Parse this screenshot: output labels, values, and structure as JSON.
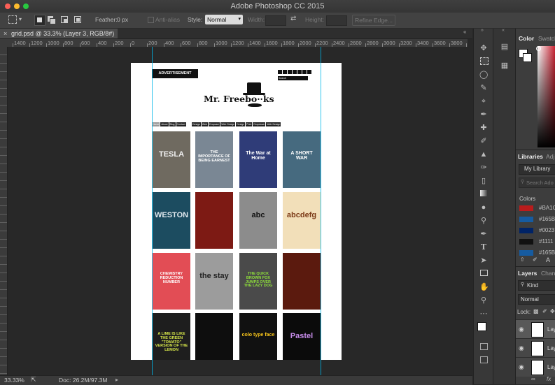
{
  "app": {
    "title": "Adobe Photoshop CC 2015"
  },
  "options_bar": {
    "feather_label": "Feather:",
    "feather_value": "0 px",
    "antialias_label": "Anti-alias",
    "style_label": "Style:",
    "style_value": "Normal",
    "width_label": "Width:",
    "height_label": "Height:",
    "refine_edge_label": "Refine Edge..."
  },
  "document": {
    "tab_title": "grid.psd @ 33.3% (Layer 3, RGB/8#) *"
  },
  "ruler": {
    "ticks": [
      "1400",
      "1200",
      "1000",
      "800",
      "600",
      "400",
      "200",
      "0",
      "200",
      "400",
      "600",
      "800",
      "1000",
      "1200",
      "1400",
      "1600",
      "1800",
      "2000",
      "2200",
      "2400",
      "2600",
      "2800",
      "3000",
      "3200",
      "3400",
      "3600",
      "3800",
      "4000"
    ]
  },
  "site": {
    "ad_label": "ADVERTISEMENT",
    "brand_name": "Mr. Freebo··ks",
    "search_label": "Search",
    "nav_left": [
      "Home",
      "About",
      "Blog",
      "Contact"
    ],
    "nav_right": [
      "Design",
      "Web",
      "Dropcam",
      "Web Design",
      "Design",
      "Print",
      "Dropdown",
      "Web Design"
    ],
    "books": [
      {
        "title": "TESLA",
        "subtitle": "",
        "bg": "#6f6a60",
        "fg": "#f0f0f0"
      },
      {
        "title": "THE IMPORTANCE OF BEING EARNEST",
        "subtitle": "",
        "bg": "#7a8794",
        "fg": "#ffffff"
      },
      {
        "title": "The War at Home",
        "subtitle": "",
        "bg": "#2f3c78",
        "fg": "#ffffff"
      },
      {
        "title": "A SHORT WAR",
        "subtitle": "",
        "bg": "#466a7f",
        "fg": "#ffffff"
      },
      {
        "title": "WESTON",
        "subtitle": "",
        "bg": "#1c4c60",
        "fg": "#e0e8ee"
      },
      {
        "title": "",
        "subtitle": "",
        "bg": "#7d1a14",
        "fg": "#ffffff"
      },
      {
        "title": "abc",
        "subtitle": "",
        "bg": "#8c8c8c",
        "fg": "#111111"
      },
      {
        "title": "abcdefg",
        "subtitle": "",
        "bg": "#f2dfb9",
        "fg": "#7c3a17"
      },
      {
        "title": "CHEMISTRY REDUCTION NUMBER",
        "subtitle": "",
        "bg": "#e24d55",
        "fg": "#ffffff"
      },
      {
        "title": "the stay",
        "subtitle": "",
        "bg": "#9c9c9c",
        "fg": "#222222"
      },
      {
        "title": "THE QUICK BROWN FOX JUMPS OVER THE LAZY DOG",
        "subtitle": "",
        "bg": "#4a4a4a",
        "fg": "#8fe03a"
      },
      {
        "title": "",
        "subtitle": "",
        "bg": "#5b1a0e",
        "fg": "#d99c6b"
      },
      {
        "title": "A LIME IS LIKE THE GREEN \"TOMATO\" VERSION OF THE LEMON",
        "subtitle": "",
        "bg": "#1e1e1e",
        "fg": "#d6e64a"
      },
      {
        "title": "",
        "subtitle": "",
        "bg": "#0e0e0e",
        "fg": "#ffffff"
      },
      {
        "title": "colo type face",
        "subtitle": "",
        "bg": "#111111",
        "fg": "#f6c31a"
      },
      {
        "title": "Pastel",
        "subtitle": "",
        "bg": "#0b0b0b",
        "fg": "#c58be8"
      }
    ]
  },
  "status": {
    "zoom": "33.33%",
    "doc_info": "Doc: 26.2M/97.3M"
  },
  "panels": {
    "color_tab": "Color",
    "swatches_tab": "Swatch",
    "libraries_tab": "Libraries",
    "adjust_tab": "Adj",
    "library_name": "My Library",
    "search_placeholder": "Search Ado",
    "colors_label": "Colors",
    "colors": [
      {
        "hex": "#BA1C1C",
        "label": "#BA1C"
      },
      {
        "hex": "#165BA0",
        "label": "#165B"
      },
      {
        "hex": "#002366",
        "label": "#0023"
      },
      {
        "hex": "#111111",
        "label": "#1111"
      },
      {
        "hex": "#165BA0",
        "label": "#165B"
      }
    ],
    "layers_tab": "Layers",
    "channels_tab": "Chan",
    "kind_label": "Kind",
    "blend_mode": "Normal",
    "lock_label": "Lock:",
    "layers": [
      {
        "name": "Lay"
      },
      {
        "name": "Lay"
      },
      {
        "name": "Lay"
      }
    ],
    "fx_label": "fx"
  }
}
